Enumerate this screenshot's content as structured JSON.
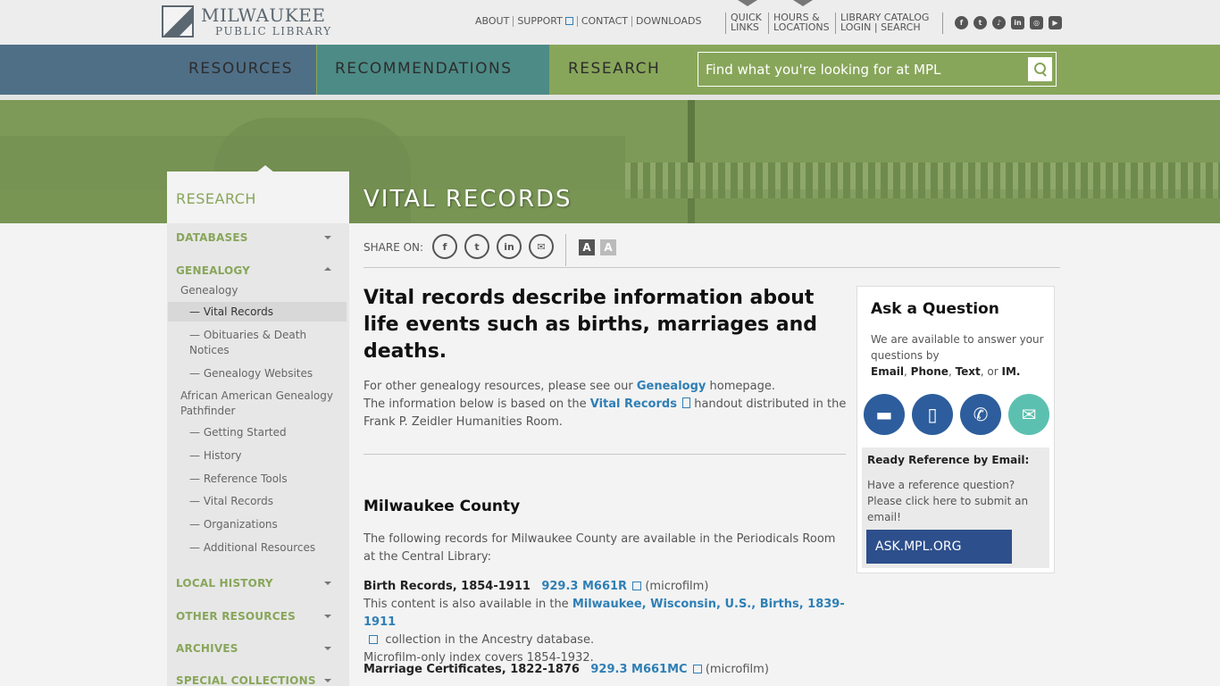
{
  "header": {
    "logo_line1": "MILWAUKEE",
    "logo_line2": "PUBLIC LIBRARY",
    "links": [
      "ABOUT",
      "SUPPORT",
      "CONTACT",
      "DOWNLOADS"
    ],
    "quick_links": [
      "QUICK",
      "LINKS"
    ],
    "hours": [
      "HOURS &",
      "LOCATIONS"
    ],
    "library_catalog": "LIBRARY CATALOG",
    "login": "LOGIN",
    "search": "SEARCH",
    "social": [
      "facebook-icon",
      "twitter-icon",
      "tiktok-icon",
      "linkedin-icon",
      "instagram-icon",
      "youtube-icon"
    ]
  },
  "nav": {
    "resources": "RESOURCES",
    "recommendations": "RECOMMENDATIONS",
    "research": "RESEARCH",
    "search_placeholder": "Find what you're looking for at MPL",
    "colors": {
      "resources": "#4f6f87",
      "recommendations": "#4d8b86",
      "research": "#88a65a"
    }
  },
  "banner": {
    "title": "VITAL RECORDS"
  },
  "sidebar": {
    "heading": "RESEARCH",
    "databases": "DATABASES",
    "genealogy": "GENEALOGY",
    "genealogy_link": "Genealogy",
    "vital_records": "— Vital Records",
    "obituaries": "— Obituaries & Death Notices",
    "genealogy_websites": "— Genealogy Websites",
    "aa_pathfinder": "African American Genealogy Pathfinder",
    "getting_started": "— Getting Started",
    "history": "— History",
    "reference_tools": "— Reference Tools",
    "vital_records_2": "— Vital Records",
    "organizations": "— Organizations",
    "additional_resources": "— Additional Resources",
    "local_history": "LOCAL HISTORY",
    "other_resources": "OTHER RESOURCES",
    "archives": "ARCHIVES",
    "special_collections": "SPECIAL COLLECTIONS"
  },
  "share": {
    "label": "SHARE ON:"
  },
  "content": {
    "lead": "Vital records describe information about life events such as births, marriages and deaths.",
    "p1_pre": "For other genealogy resources, please see our ",
    "p1_link": "Genealogy",
    "p1_post": " homepage.",
    "p2_pre": "The information below is based on the ",
    "p2_link": "Vital Records",
    "p2_post": " handout distributed in the Frank P. Zeidler Humanities Room.",
    "county_heading": "Milwaukee County",
    "county_intro": "The following records for Milwaukee County are available in the Periodicals Room at the Central Library:",
    "birth_title": "Birth Records, 1854-1911",
    "birth_call": "929.3 M661R",
    "birth_format": "(microfilm)",
    "birth_also_pre": "This content is also available in the ",
    "birth_also_link": "Milwaukee, Wisconsin, U.S., Births, 1839-1911",
    "birth_also_post": " collection in the Ancestry database.",
    "birth_index": "Microfilm-only index covers 1854-1932.",
    "marriage_title": "Marriage Certificates, 1822-1876",
    "marriage_call": "929.3 M661MC",
    "marriage_format": "(microfilm)"
  },
  "ask": {
    "title": "Ask a Question",
    "intro": "We are available to answer your questions by",
    "channels": [
      "Email",
      "Phone",
      "Text",
      "IM."
    ],
    "ready_title": "Ready Reference by Email:",
    "ready_text": "Have a reference question? Please click here to submit an email!",
    "button": "ASK.MPL.ORG"
  }
}
